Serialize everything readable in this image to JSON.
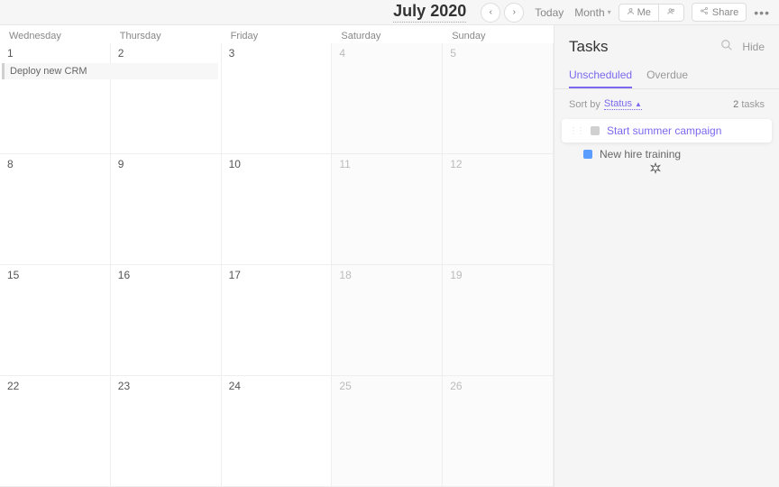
{
  "header": {
    "title": "July 2020",
    "today": "Today",
    "view": "Month",
    "me": "Me",
    "share": "Share"
  },
  "weekdays": [
    "Wednesday",
    "Thursday",
    "Friday",
    "Saturday",
    "Sunday"
  ],
  "weeks": [
    [
      {
        "num": "1",
        "weekend": false,
        "event": "Deploy new CRM"
      },
      {
        "num": "2",
        "weekend": false
      },
      {
        "num": "3",
        "weekend": false
      },
      {
        "num": "4",
        "weekend": true
      },
      {
        "num": "5",
        "weekend": true
      }
    ],
    [
      {
        "num": "8",
        "weekend": false
      },
      {
        "num": "9",
        "weekend": false
      },
      {
        "num": "10",
        "weekend": false
      },
      {
        "num": "11",
        "weekend": true
      },
      {
        "num": "12",
        "weekend": true
      }
    ],
    [
      {
        "num": "15",
        "weekend": false
      },
      {
        "num": "16",
        "weekend": false
      },
      {
        "num": "17",
        "weekend": false
      },
      {
        "num": "18",
        "weekend": true
      },
      {
        "num": "19",
        "weekend": true
      }
    ],
    [
      {
        "num": "22",
        "weekend": false
      },
      {
        "num": "23",
        "weekend": false
      },
      {
        "num": "24",
        "weekend": false
      },
      {
        "num": "25",
        "weekend": true
      },
      {
        "num": "26",
        "weekend": true
      }
    ]
  ],
  "sidebar": {
    "title": "Tasks",
    "hide": "Hide",
    "tabs": {
      "unscheduled": "Unscheduled",
      "overdue": "Overdue"
    },
    "sortBy": "Sort by",
    "sortVal": "Status",
    "countNum": "2",
    "countLabel": "tasks",
    "tasks": [
      {
        "name": "Start summer campaign",
        "status": "draft"
      },
      {
        "name": "New hire training",
        "status": "active"
      }
    ]
  }
}
